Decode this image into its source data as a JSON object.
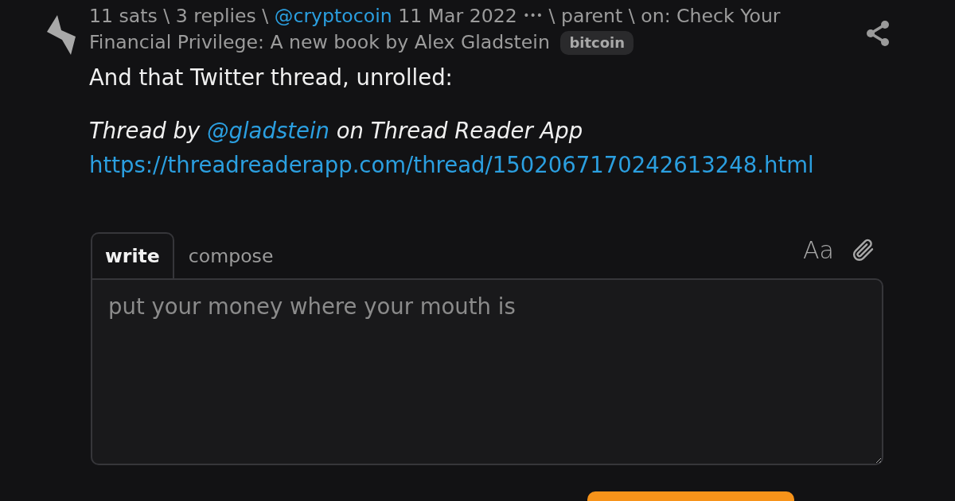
{
  "item": {
    "meta": {
      "stats": "11 sats \\ 3 replies \\",
      "author": "@cryptocoin",
      "date": "11 Mar 2022",
      "more": "•••",
      "context": "\\ parent \\ on: Check Your Financial Privilege: A new book by Alex Gladstein",
      "tag": "bitcoin"
    },
    "text": "And that Twitter thread, unrolled:",
    "credit": {
      "before": "Thread by",
      "handle": "@gladstein",
      "after": "on Thread Reader App"
    },
    "url": "https://threadreaderapp.com/thread/1502067170242613248.html"
  },
  "reply_form": {
    "tabs": [
      {
        "label": "write",
        "selected": true
      },
      {
        "label": "compose",
        "selected": false
      }
    ],
    "format_toggle": "Aa",
    "placeholder": "put your money where your mouth is"
  }
}
